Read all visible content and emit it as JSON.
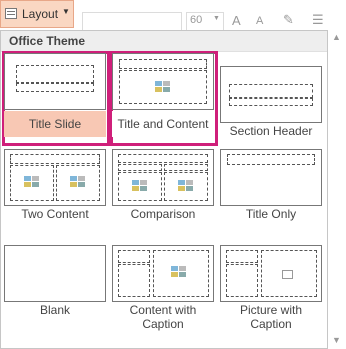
{
  "ribbon": {
    "layout_label": "Layout",
    "font_size": "60",
    "increase_font": "A",
    "decrease_font": "A"
  },
  "gallery": {
    "header": "Office Theme",
    "layouts": [
      {
        "label": "Title Slide"
      },
      {
        "label": "Title and Content"
      },
      {
        "label": "Section Header"
      },
      {
        "label": "Two Content"
      },
      {
        "label": "Comparison"
      },
      {
        "label": "Title Only"
      },
      {
        "label": "Blank"
      },
      {
        "label": "Content with\nCaption"
      },
      {
        "label": "Picture with\nCaption"
      }
    ]
  },
  "colors": {
    "accent": "#cf1f7a",
    "hover_fill": "#f8c8b4"
  }
}
